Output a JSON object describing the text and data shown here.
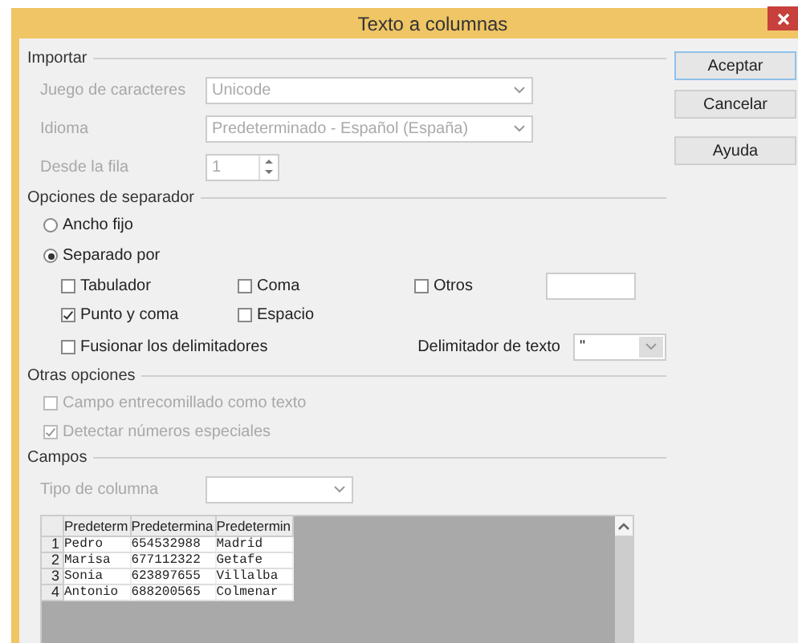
{
  "window": {
    "title": "Texto a columnas"
  },
  "import": {
    "legend": "Importar",
    "fields": [
      {
        "label": "Juego de caracteres",
        "value": "Unicode",
        "kind": "combo",
        "disabled": true
      },
      {
        "label": "Idioma",
        "value": "Predeterminado - Español (España)",
        "kind": "combo",
        "disabled": true
      },
      {
        "label": "Desde la fila",
        "value": "1",
        "kind": "spin",
        "disabled": true
      }
    ]
  },
  "separator_options": {
    "legend": "Opciones de separador",
    "modes": [
      {
        "label": "Ancho fijo",
        "selected": false
      },
      {
        "label": "Separado por",
        "selected": true
      }
    ],
    "separators": [
      {
        "label": "Tabulador",
        "checked": false
      },
      {
        "label": "Coma",
        "checked": false
      },
      {
        "label": "Otros",
        "checked": false
      },
      {
        "label": "Punto y coma",
        "checked": true
      },
      {
        "label": "Espacio",
        "checked": false
      }
    ],
    "merge": {
      "label": "Fusionar los delimitadores",
      "checked": false
    },
    "text_delimiter": {
      "label": "Delimitador de texto",
      "value": "\""
    }
  },
  "other_options": {
    "legend": "Otras opciones",
    "options": [
      {
        "label": "Campo entrecomillado como texto",
        "checked": false,
        "disabled": true
      },
      {
        "label": "Detectar números especiales",
        "checked": true,
        "disabled": true
      }
    ]
  },
  "fields": {
    "legend": "Campos",
    "column_type": {
      "label": "Tipo de columna",
      "disabled": true
    },
    "preview": {
      "columns": [
        "Predeterm",
        "Predetermina",
        "Predetermin"
      ],
      "rows": [
        {
          "number": "1",
          "cells": [
            "Pedro",
            "654532988",
            "Madrid"
          ]
        },
        {
          "number": "2",
          "cells": [
            "Marisa",
            "677112322",
            "Getafe"
          ]
        },
        {
          "number": "3",
          "cells": [
            "Sonia",
            "623897655",
            "Villalba"
          ]
        },
        {
          "number": "4",
          "cells": [
            "Antonio",
            "688200565",
            "Colmenar"
          ]
        }
      ]
    }
  },
  "buttons": [
    "Aceptar",
    "Cancelar",
    "Ayuda"
  ]
}
